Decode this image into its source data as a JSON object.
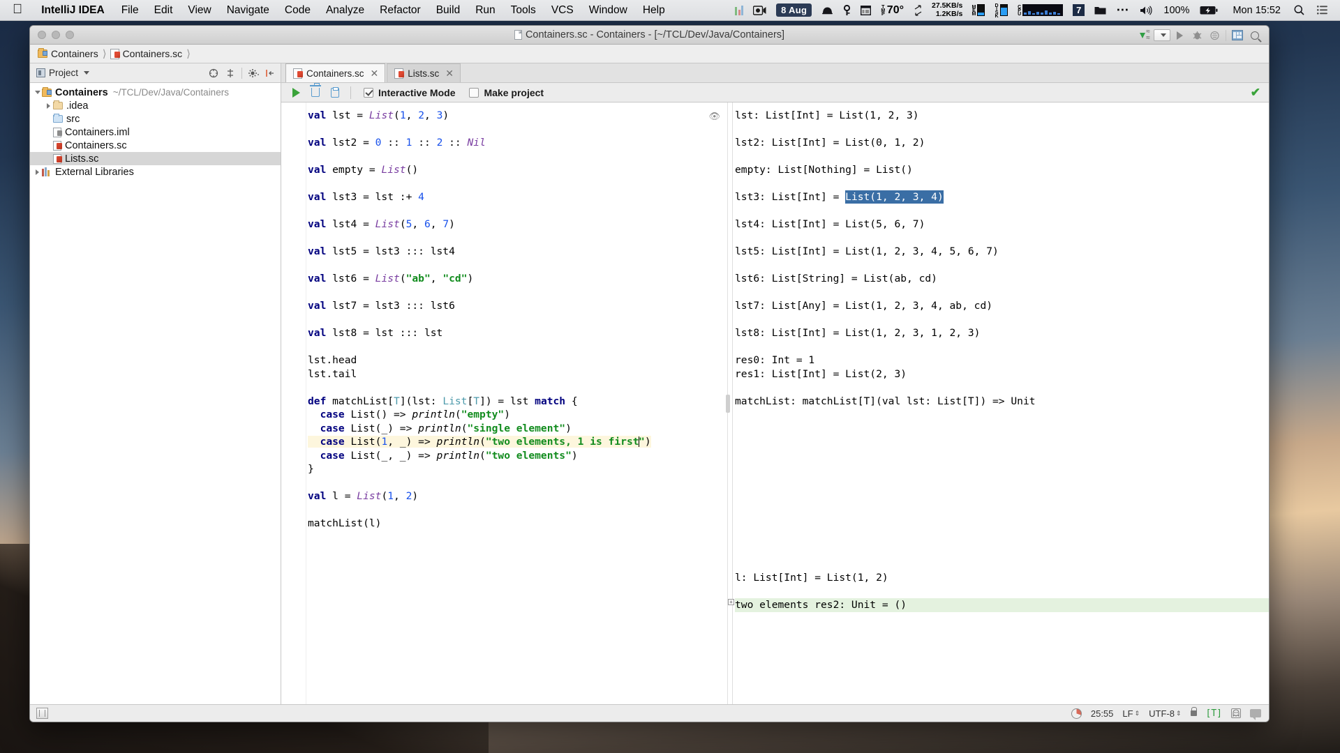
{
  "menubar": {
    "apple_icon": "apple-logo",
    "app_name": "IntelliJ IDEA",
    "items": [
      "File",
      "Edit",
      "View",
      "Navigate",
      "Code",
      "Analyze",
      "Refactor",
      "Build",
      "Run",
      "Tools",
      "VCS",
      "Window",
      "Help"
    ],
    "status_items": {
      "date_badge": "8 Aug",
      "temperature": "70°",
      "net_down": "27.5KB/s",
      "net_up": "1.2KB/s",
      "mem_label": "MEM",
      "disk_label": "DISK",
      "cpu_label": "CPU",
      "seven_badge": "7",
      "volume_percent": "100%",
      "clock": "Mon 15:52"
    },
    "icons": [
      "bars-icon",
      "camera-icon",
      "calendar-badge-icon",
      "bell-icon",
      "key-icon",
      "window-icon",
      "thermometer-icon",
      "network-arrows-icon",
      "mem-meter-icon",
      "disk-meter-icon",
      "cpu-graph-icon",
      "folder-icon",
      "ellipsis-icon",
      "volume-icon",
      "battery-icon",
      "spotlight-search-icon",
      "control-center-icon"
    ]
  },
  "window": {
    "title": "Containers.sc - Containers - [~/TCL/Dev/Java/Containers]"
  },
  "breadcrumb": {
    "items": [
      "Containers",
      "Containers.sc"
    ]
  },
  "toolbar": {
    "project_label": "Project",
    "icons": [
      "collapse-all-icon",
      "target-icon",
      "settings-gear-icon",
      "hide-panel-icon"
    ],
    "top_right_icons": [
      "update-project-icon",
      "run-config-dropdown",
      "run-icon",
      "debug-icon",
      "coverage-icon",
      "layout-icon",
      "search-everywhere-icon"
    ]
  },
  "tabs": [
    {
      "label": "Containers.sc",
      "active": true
    },
    {
      "label": "Lists.sc",
      "active": false
    }
  ],
  "sidebar": {
    "tree": [
      {
        "label": "Containers",
        "hint": "~/TCL/Dev/Java/Containers",
        "indent": 0,
        "twisty": "open",
        "icon": "project-folder-icon",
        "bold": true,
        "selected": false
      },
      {
        "label": ".idea",
        "hint": "",
        "indent": 1,
        "twisty": "closed",
        "icon": "folder-tan-icon",
        "bold": false,
        "selected": false
      },
      {
        "label": "src",
        "hint": "",
        "indent": 1,
        "twisty": "none",
        "icon": "folder-blue-icon",
        "bold": false,
        "selected": false
      },
      {
        "label": "Containers.iml",
        "hint": "",
        "indent": 1,
        "twisty": "none",
        "icon": "iml-file-icon",
        "bold": false,
        "selected": false
      },
      {
        "label": "Containers.sc",
        "hint": "",
        "indent": 1,
        "twisty": "none",
        "icon": "scala-file-icon",
        "bold": false,
        "selected": false
      },
      {
        "label": "Lists.sc",
        "hint": "",
        "indent": 1,
        "twisty": "none",
        "icon": "scala-file-icon",
        "bold": false,
        "selected": true
      },
      {
        "label": "External Libraries",
        "hint": "",
        "indent": 0,
        "twisty": "closed",
        "icon": "libraries-icon",
        "bold": false,
        "selected": false
      }
    ]
  },
  "run_toolbar": {
    "run_icon": "run-play-icon",
    "clear_icon": "trash-icon",
    "copy_icon": "copy-icon",
    "interactive_mode": {
      "label": "Interactive Mode",
      "checked": true
    },
    "make_project": {
      "label": "Make project",
      "checked": false
    },
    "status_ok": "✔"
  },
  "code": {
    "lines": [
      "val lst = List(1, 2, 3)",
      "",
      "val lst2 = 0 :: 1 :: 2 :: Nil",
      "",
      "val empty = List()",
      "",
      "val lst3 = lst :+ 4",
      "",
      "val lst4 = List(5, 6, 7)",
      "",
      "val lst5 = lst3 ::: lst4",
      "",
      "val lst6 = List(\"ab\", \"cd\")",
      "",
      "val lst7 = lst3 ::: lst6",
      "",
      "val lst8 = lst ::: lst",
      "",
      "lst.head",
      "lst.tail",
      "",
      "def matchList[T](lst: List[T]) = lst match {",
      "  case List() => println(\"empty\")",
      "  case List(_) => println(\"single element\")",
      "  case List(1, _) => println(\"two elements, 1 is first\")",
      "  case List(_, _) => println(\"two elements\")",
      "}",
      "",
      "val l = List(1, 2)",
      "",
      "matchList(l)"
    ],
    "highlighted_line": "  case List(1, _) => println(\"two elements, 1 is first\")",
    "eye_icon": "eye-icon"
  },
  "results": {
    "lines": [
      "lst: List[Int] = List(1, 2, 3)",
      "",
      "lst2: List[Int] = List(0, 1, 2)",
      "",
      "empty: List[Nothing] = List()",
      "",
      "lst3: List[Int] = List(1, 2, 3, 4)",
      "",
      "lst4: List[Int] = List(5, 6, 7)",
      "",
      "lst5: List[Int] = List(1, 2, 3, 4, 5, 6, 7)",
      "",
      "lst6: List[String] = List(ab, cd)",
      "",
      "lst7: List[Any] = List(1, 2, 3, 4, ab, cd)",
      "",
      "lst8: List[Int] = List(1, 2, 3, 1, 2, 3)",
      "",
      "res0: Int = 1",
      "res1: List[Int] = List(2, 3)",
      "",
      "matchList: matchList[T](val lst: List[T]) => Unit"
    ],
    "selected_text": "List(1, 2, 3, 4)",
    "bottom_lines": [
      "l: List[Int] = List(1, 2)",
      "two elements res2: Unit = ()"
    ],
    "fold_marker": "+"
  },
  "statusbar": {
    "left_icon": "toggle-tool-window-icon",
    "position": "25:55",
    "line_separator": "LF",
    "encoding": "UTF-8",
    "lock_icon": "lock-icon",
    "indent_badge": "[T]",
    "ghost_icon": "ghost-icon",
    "notification_icon": "notification-icon"
  },
  "colors": {
    "keyword": "#00007f",
    "class_italic": "#7a3ea1",
    "type": "#4d9aab",
    "number": "#1750eb",
    "string": "#128c1e",
    "selection": "#3a6ea5",
    "output_bg": "#e4f2df",
    "highlight_line": "#fdf6dd",
    "accent_green": "#3aa33a"
  }
}
